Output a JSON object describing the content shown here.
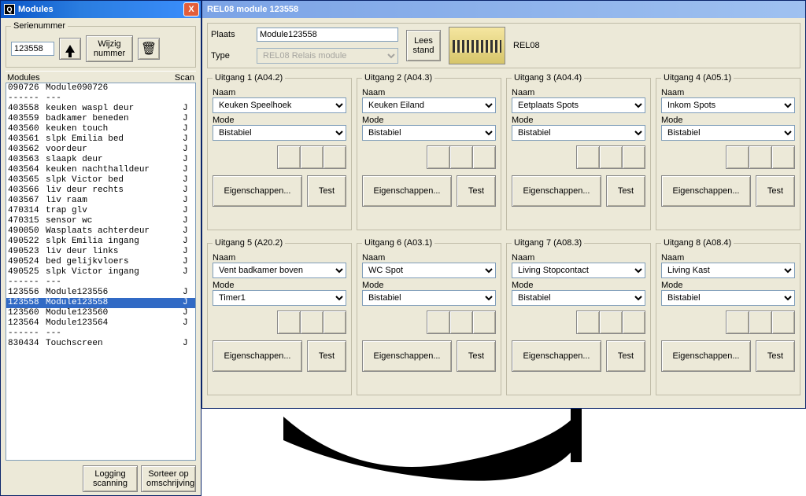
{
  "modules_window": {
    "title": "Modules",
    "close_label": "X",
    "serienummer": {
      "legend": "Serienummer",
      "value": "123558",
      "wijzig_label": "Wijzig\nnummer"
    },
    "headers": {
      "modules": "Modules",
      "scan": "Scan"
    },
    "rows": [
      {
        "id": "090726",
        "name": "Module090726",
        "scan": ""
      },
      {
        "id": "------",
        "name": "---",
        "scan": ""
      },
      {
        "id": "403558",
        "name": "keuken waspl deur",
        "scan": "J"
      },
      {
        "id": "403559",
        "name": "badkamer beneden",
        "scan": "J"
      },
      {
        "id": "403560",
        "name": "keuken touch",
        "scan": "J"
      },
      {
        "id": "403561",
        "name": "slpk Emilia bed",
        "scan": "J"
      },
      {
        "id": "403562",
        "name": "voordeur",
        "scan": "J"
      },
      {
        "id": "403563",
        "name": "slaapk deur",
        "scan": "J"
      },
      {
        "id": "403564",
        "name": "keuken nachthalldeur",
        "scan": "J"
      },
      {
        "id": "403565",
        "name": "slpk Victor bed",
        "scan": "J"
      },
      {
        "id": "403566",
        "name": "liv deur rechts",
        "scan": "J"
      },
      {
        "id": "403567",
        "name": "liv raam",
        "scan": "J"
      },
      {
        "id": "470314",
        "name": "trap glv",
        "scan": "J"
      },
      {
        "id": "470315",
        "name": "sensor wc",
        "scan": "J"
      },
      {
        "id": "490050",
        "name": "Wasplaats achterdeur",
        "scan": "J"
      },
      {
        "id": "490522",
        "name": "slpk Emilia ingang",
        "scan": "J"
      },
      {
        "id": "490523",
        "name": "liv deur links",
        "scan": "J"
      },
      {
        "id": "490524",
        "name": "bed gelijkvloers",
        "scan": "J"
      },
      {
        "id": "490525",
        "name": "slpk Victor ingang",
        "scan": "J"
      },
      {
        "id": "------",
        "name": "---",
        "scan": ""
      },
      {
        "id": "123556",
        "name": "Module123556",
        "scan": "J"
      },
      {
        "id": "123558",
        "name": "Module123558",
        "scan": "J",
        "selected": true
      },
      {
        "id": "123560",
        "name": "Module123560",
        "scan": "J"
      },
      {
        "id": "123564",
        "name": "Module123564",
        "scan": "J"
      },
      {
        "id": "------",
        "name": "---",
        "scan": ""
      },
      {
        "id": "830434",
        "name": "Touchscreen",
        "scan": "J"
      }
    ],
    "logging_label": "Logging\nscanning",
    "sort_label": "Sorteer op\nomschrijving"
  },
  "detail_window": {
    "title": "REL08 module 123558",
    "plaats_label": "Plaats",
    "plaats_value": "Module123558",
    "type_label": "Type",
    "type_value": "REL08 Relais module",
    "lees_label": "Lees\nstand",
    "device_name": "REL08",
    "labels": {
      "naam": "Naam",
      "mode": "Mode",
      "eigenschappen": "Eigenschappen...",
      "test": "Test"
    },
    "uitgangen": [
      {
        "legend": "Uitgang 1 (A04.2)",
        "naam": "Keuken Speelhoek",
        "mode": "Bistabiel"
      },
      {
        "legend": "Uitgang 2 (A04.3)",
        "naam": "Keuken Eiland",
        "mode": "Bistabiel"
      },
      {
        "legend": "Uitgang 3 (A04.4)",
        "naam": "Eetplaats Spots",
        "mode": "Bistabiel"
      },
      {
        "legend": "Uitgang 4 (A05.1)",
        "naam": "Inkom Spots",
        "mode": "Bistabiel"
      },
      {
        "legend": "Uitgang 5 (A20.2)",
        "naam": "Vent badkamer boven",
        "mode": "Timer1"
      },
      {
        "legend": "Uitgang 6 (A03.1)",
        "naam": "WC Spot",
        "mode": "Bistabiel"
      },
      {
        "legend": "Uitgang 7 (A08.3)",
        "naam": "Living Stopcontact",
        "mode": "Bistabiel"
      },
      {
        "legend": "Uitgang 8 (A08.4)",
        "naam": "Living Kast",
        "mode": "Bistabiel"
      }
    ]
  }
}
